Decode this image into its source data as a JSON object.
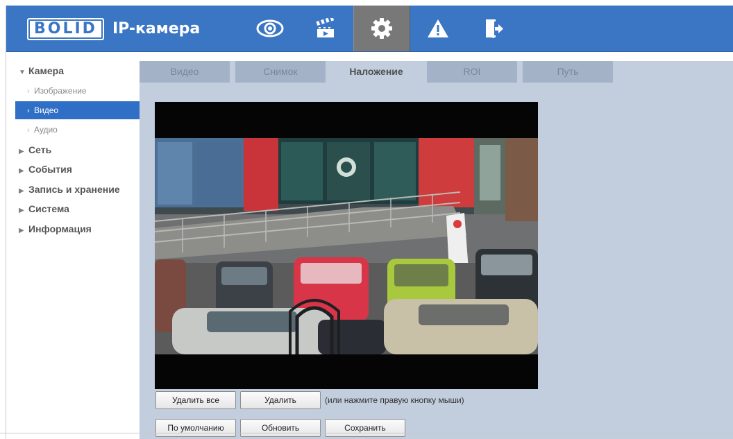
{
  "header": {
    "logo_brand": "BOLID",
    "logo_product": "IP-камера",
    "bg_color": "#3a76c4",
    "nav": [
      {
        "icon": "eye-icon",
        "active": false
      },
      {
        "icon": "clapperboard-icon",
        "active": false
      },
      {
        "icon": "gear-icon",
        "active": true
      },
      {
        "icon": "warning-icon",
        "active": false
      },
      {
        "icon": "logout-icon",
        "active": false
      }
    ]
  },
  "sidebar": {
    "sections": [
      {
        "label": "Камера",
        "expanded": true,
        "children": [
          {
            "label": "Изображение",
            "active": false
          },
          {
            "label": "Видео",
            "active": true
          },
          {
            "label": "Аудио",
            "active": false
          }
        ]
      },
      {
        "label": "Сеть",
        "expanded": false
      },
      {
        "label": "События",
        "expanded": false
      },
      {
        "label": "Запись и хранение",
        "expanded": false
      },
      {
        "label": "Система",
        "expanded": false
      },
      {
        "label": "Информация",
        "expanded": false
      }
    ],
    "active_color": "#2f6fc6"
  },
  "tabs": [
    {
      "label": "Видео",
      "active": false
    },
    {
      "label": "Снимок",
      "active": false
    },
    {
      "label": "Наложение",
      "active": true
    },
    {
      "label": "ROI",
      "active": false
    },
    {
      "label": "Путь",
      "active": false
    }
  ],
  "buttons": {
    "delete_all": "Удалить все",
    "delete": "Удалить",
    "hint": "(или нажмите правую кнопку мыши)",
    "default": "По умолчанию",
    "refresh": "Обновить",
    "save": "Сохранить"
  }
}
